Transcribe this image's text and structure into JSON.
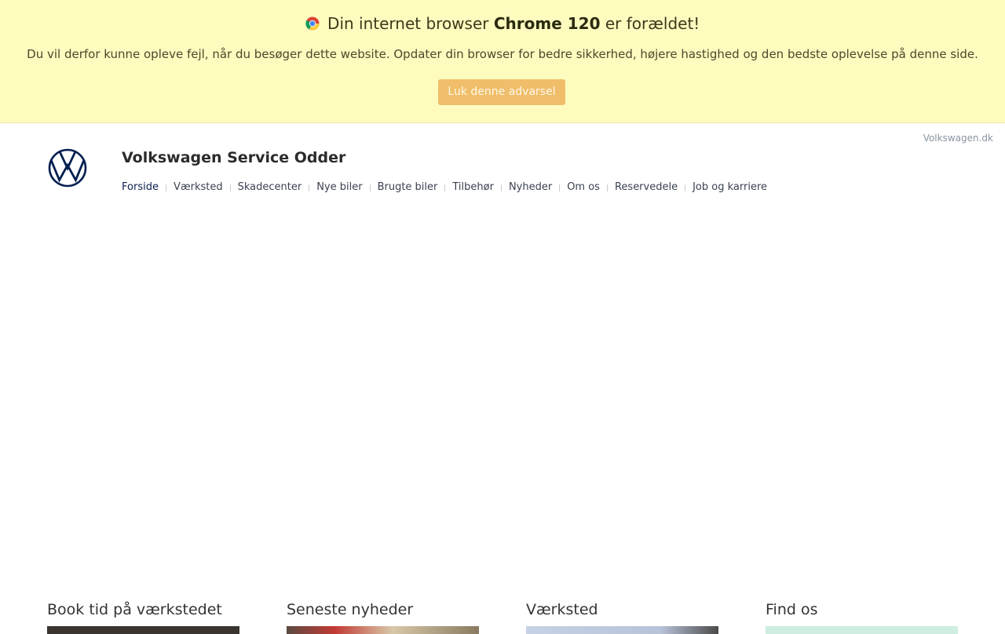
{
  "browser_warning": {
    "title_prefix": "Din internet browser",
    "browser_name": "Chrome 120",
    "title_suffix": "er forældet!",
    "message": "Du vil derfor kunne opleve fejl, når du besøger dette website. Opdater din browser for bedre sikkerhed, højere hastighed og den bedste oplevelse på denne side.",
    "close_label": "Luk denne advarsel",
    "colors": {
      "background": "#fefbbf",
      "button": "#f0be6a"
    }
  },
  "header": {
    "top_link": "Volkswagen.dk",
    "logo_icon": "volkswagen-logo-icon",
    "site_title": "Volkswagen Service Odder",
    "nav": [
      {
        "label": "Forside",
        "active": true
      },
      {
        "label": "Værksted",
        "active": false
      },
      {
        "label": "Skadecenter",
        "active": false
      },
      {
        "label": "Nye biler",
        "active": false
      },
      {
        "label": "Brugte biler",
        "active": false
      },
      {
        "label": "Tilbehør",
        "active": false
      },
      {
        "label": "Nyheder",
        "active": false
      },
      {
        "label": "Om os",
        "active": false
      },
      {
        "label": "Reservedele",
        "active": false
      },
      {
        "label": "Job og karriere",
        "active": false
      }
    ],
    "brand_color": "#001e50"
  },
  "columns": [
    {
      "title": "Book tid på værkstedet",
      "thumb_color": "#3a3530"
    },
    {
      "title": "Seneste nyheder",
      "thumb_color": "#b8443a"
    },
    {
      "title": "Værksted",
      "thumb_color": "#c8d2e6"
    },
    {
      "title": "Find os",
      "thumb_color": "#cfeee0"
    }
  ]
}
